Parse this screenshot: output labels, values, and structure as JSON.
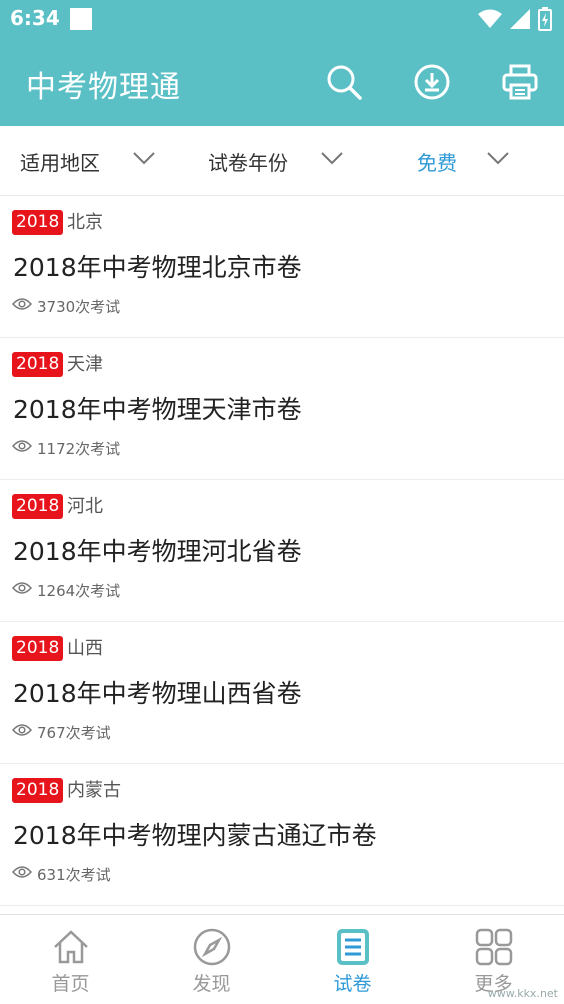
{
  "status_bar": {
    "time": "6:34"
  },
  "app_bar": {
    "title": "中考物理通",
    "icons": [
      "search-icon",
      "download-icon",
      "print-icon"
    ]
  },
  "filters": [
    {
      "label": "适用地区",
      "active": false
    },
    {
      "label": "试卷年份",
      "active": false
    },
    {
      "label": "免费",
      "active": true
    }
  ],
  "papers": [
    {
      "year": "2018",
      "region": "北京",
      "title": "2018年中考物理北京市卷",
      "count": "3730次考试"
    },
    {
      "year": "2018",
      "region": "天津",
      "title": "2018年中考物理天津市卷",
      "count": "1172次考试"
    },
    {
      "year": "2018",
      "region": "河北",
      "title": "2018年中考物理河北省卷",
      "count": "1264次考试"
    },
    {
      "year": "2018",
      "region": "山西",
      "title": "2018年中考物理山西省卷",
      "count": "767次考试"
    },
    {
      "year": "2018",
      "region": "内蒙古",
      "title": "2018年中考物理内蒙古通辽市卷",
      "count": "631次考试"
    }
  ],
  "bottom_nav": [
    {
      "label": "首页",
      "icon": "home-icon",
      "active": false
    },
    {
      "label": "发现",
      "icon": "compass-icon",
      "active": false
    },
    {
      "label": "试卷",
      "icon": "document-icon",
      "active": true
    },
    {
      "label": "更多",
      "icon": "grid-icon",
      "active": false
    }
  ],
  "watermark": "www.kkx.net",
  "colors": {
    "primary": "#5ac0c6",
    "accent": "#2f9ad7",
    "tag": "#e8141c"
  }
}
